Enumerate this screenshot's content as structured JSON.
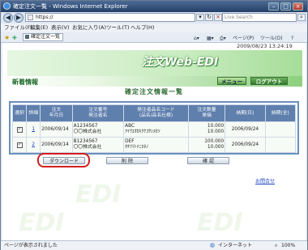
{
  "window": {
    "title": "確定注文一覧 - Windows Internet Explorer",
    "minimize_glyph": "–",
    "maximize_glyph": "□",
    "close_glyph": "×"
  },
  "address_bar": {
    "back_glyph": "◀",
    "forward_glyph": "▶",
    "url": "https://",
    "search_placeholder": "Live Search"
  },
  "menu": [
    "ファイル(F)",
    "編集(E)",
    "表示(V)",
    "お気に入り(A)",
    "ツール(T)",
    "ヘルプ(H)"
  ],
  "favorites_bar": {
    "tab_title": "確定注文一覧",
    "tools": [
      "ページ(P)",
      "ツール(O)"
    ]
  },
  "page": {
    "datetime": "2009/08/23 13:24:19",
    "logo": "注文Web-EDI",
    "watermark": "EDI",
    "section_title": "新着情報",
    "menu_button": "メニュー",
    "logout_button": "ログアウト",
    "page_title": "確定注文情報一覧",
    "table": {
      "headers": [
        "選択",
        "詳細",
        "注文\n年月日",
        "注文番号\n発注者名",
        "発注者品名コード\n(品名/品名仕様)",
        "注文数量\n単価",
        "納期(日)",
        "納期(全)"
      ],
      "rows": [
        {
          "checked": "✓",
          "detail": "1",
          "date": "2006/09/14",
          "order_no": "A1234567",
          "company": "〇〇株式会社",
          "item_code": "ABC",
          "item_name": "ｱｲｳｴｵｶｷｸｹｺｻｼｽｾｿ",
          "quantity": "10.000",
          "price": "10.000",
          "due_date": "2006/09/24",
          "due_all": ""
        },
        {
          "checked": "✓",
          "detail": "2",
          "date": "2006/09/14",
          "order_no": "B1234567",
          "company": "〇〇株式会社",
          "item_code": "DEF",
          "item_name": "ﾀﾁﾂﾃﾄﾅﾆﾇﾈﾉ",
          "quantity": "100.000",
          "price": "10.000",
          "due_date": "2006/09/24",
          "due_all": ""
        }
      ]
    },
    "download_button": "ダウンロード",
    "delete_button": "削 除",
    "confirm_button": "確 認",
    "inquiry_link": "お問合せ"
  },
  "status_bar": {
    "message": "ページが表示されました",
    "zone": "インターネット",
    "zoom": "100%"
  },
  "colors": {
    "highlight_ring": "#d21d1d",
    "table_header": "#5f7fad",
    "brand_green": "#2d6b34"
  }
}
